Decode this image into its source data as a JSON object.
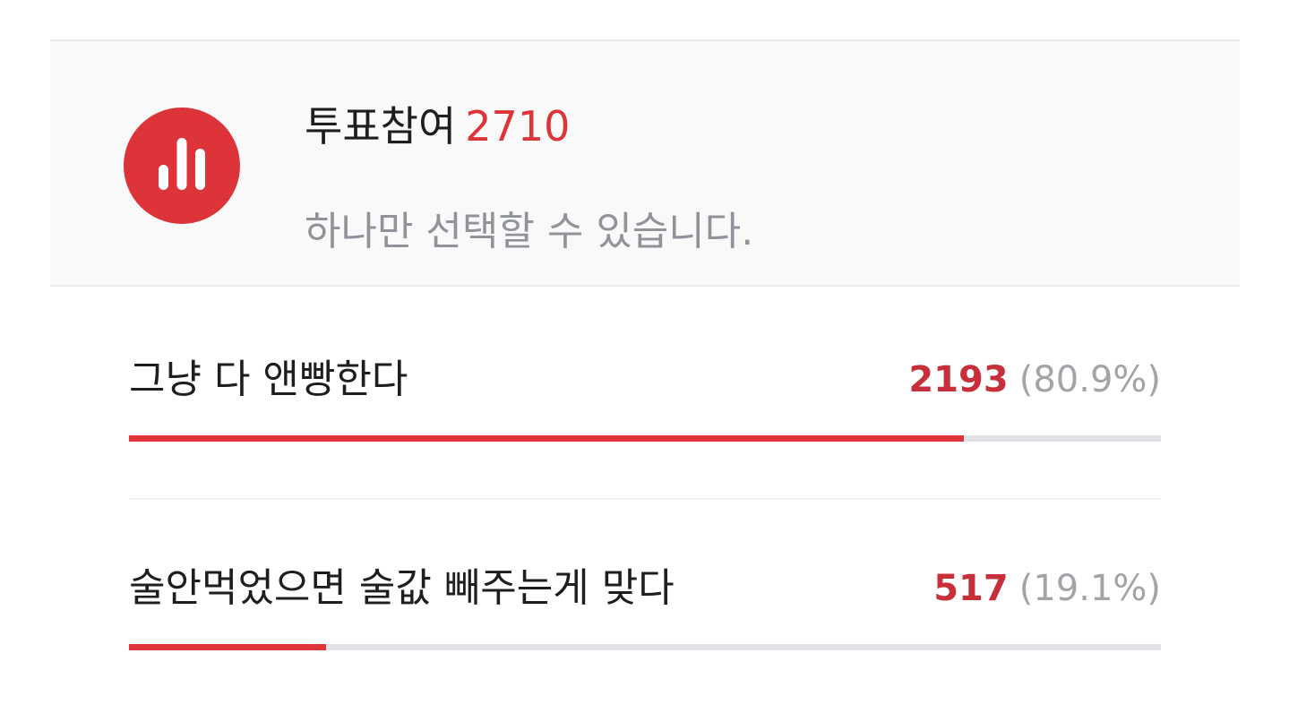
{
  "poll": {
    "title": "투표참여",
    "participants": "2710",
    "subtitle": "하나만 선택할 수 있습니다.",
    "icon": "bar-chart-icon",
    "accent_color": "#dc3439",
    "track_color": "#e1e1e6",
    "options": [
      {
        "label": "그냥 다 앤빵한다",
        "votes": "2193",
        "percent_label": "(80.9%)",
        "fill_percent": 80.9
      },
      {
        "label": "술안먹었으면 술값 빼주는게 맞다",
        "votes": "517",
        "percent_label": "(19.1%)",
        "fill_percent": 19.1
      }
    ]
  }
}
